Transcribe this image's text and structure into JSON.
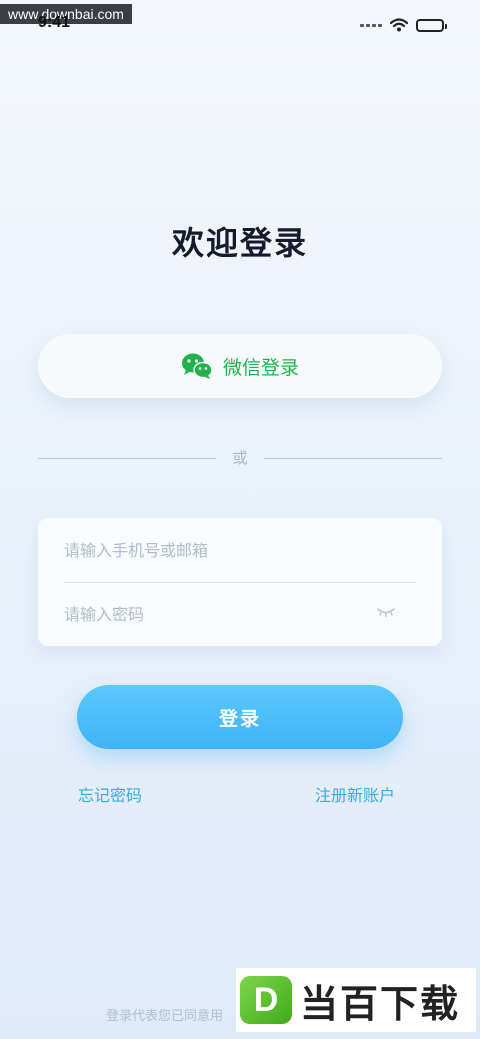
{
  "watermark": {
    "top_text": "www.downbai.com",
    "bottom_logo_letter": "D",
    "bottom_text": "当百下载"
  },
  "status_bar": {
    "time": "9:41"
  },
  "page": {
    "title": "欢迎登录"
  },
  "wechat": {
    "label": "微信登录",
    "icon": "wechat-icon",
    "color": "#22b24c"
  },
  "divider": {
    "text": "或"
  },
  "form": {
    "account_placeholder": "请输入手机号或邮箱",
    "password_placeholder": "请输入密码",
    "password_toggle_icon": "eye-closed-icon"
  },
  "login_button": {
    "label": "登录",
    "color": "#4dbdfb"
  },
  "links": {
    "forgot": "忘记密码",
    "register": "注册新账户",
    "color": "#3aa9e8"
  },
  "agreement": {
    "text": "登录代表您已同意用"
  }
}
